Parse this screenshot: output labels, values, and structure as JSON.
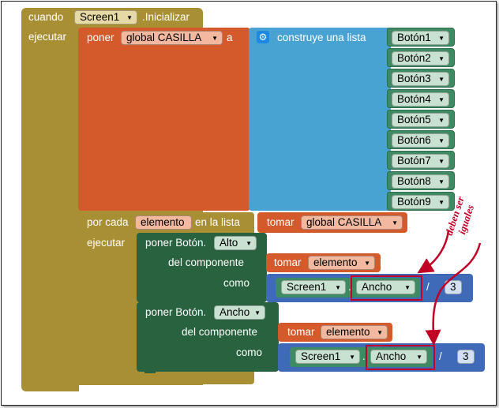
{
  "event": {
    "when": "cuando",
    "component": "Screen1",
    "event_name": ".Inicializar",
    "do": "ejecutar"
  },
  "set_global": {
    "set": "poner",
    "var": "global CASILLA",
    "to": "a"
  },
  "make_list": {
    "label": "construye una lista",
    "items": [
      "Botón1",
      "Botón2",
      "Botón3",
      "Botón4",
      "Botón5",
      "Botón6",
      "Botón7",
      "Botón8",
      "Botón9"
    ]
  },
  "foreach": {
    "for_each": "por cada",
    "item": "elemento",
    "in_list": "en la lista",
    "get": "tomar",
    "list_var": "global CASILLA",
    "do": "ejecutar"
  },
  "set1": {
    "set": "poner Botón.",
    "prop": "Alto",
    "of_component": "del componente",
    "get": "tomar",
    "var": "elemento",
    "to": "como",
    "comp": "Screen1",
    "comp_prop": "Ancho",
    "div": "/",
    "num": "3"
  },
  "set2": {
    "set": "poner Botón.",
    "prop": "Ancho",
    "of_component": "del componente",
    "get": "tomar",
    "var": "elemento",
    "to": "como",
    "comp": "Screen1",
    "comp_prop": "Ancho",
    "div": "/",
    "num": "3"
  },
  "annotation": {
    "line1": "deben ser",
    "line2": "iguales"
  },
  "colors": {
    "event": "#a98f34",
    "set_var": "#d45a2b",
    "list": "#48a3d3",
    "component": "#3e8a62",
    "set_prop": "#28623f",
    "math": "#3f6ab7",
    "annotation": "#c00024"
  }
}
